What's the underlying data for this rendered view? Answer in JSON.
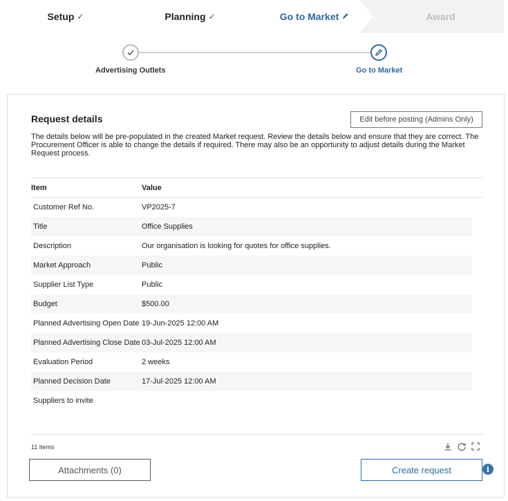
{
  "stages": [
    {
      "label": "Setup",
      "status": "done"
    },
    {
      "label": "Planning",
      "status": "done"
    },
    {
      "label": "Go to Market",
      "status": "active"
    },
    {
      "label": "Award",
      "status": "pending"
    }
  ],
  "stepper": {
    "steps": [
      {
        "label": "Advertising Outlets",
        "status": "done"
      },
      {
        "label": "Go to Market",
        "status": "active"
      }
    ]
  },
  "card": {
    "title": "Request details",
    "edit_button": "Edit before posting (Admins Only)",
    "description": "The details below will be pre-populated in the created Market request. Review the details below and ensure that they are correct. The Procurement Officer is able to change the details if required. There may also be an opportunity to adjust details during the Market Request process."
  },
  "table": {
    "headers": {
      "item": "Item",
      "value": "Value"
    },
    "rows": [
      {
        "item": "Customer Ref No.",
        "value": "VP2025-7"
      },
      {
        "item": "Title",
        "value": "Office Supplies"
      },
      {
        "item": "Description",
        "value": "Our organisation is looking for quotes for office supplies."
      },
      {
        "item": "Market Approach",
        "value": "Public"
      },
      {
        "item": "Supplier List Type",
        "value": "Public"
      },
      {
        "item": "Budget",
        "value": "$500.00"
      },
      {
        "item": "Planned Advertising Open Date",
        "value": "19-Jun-2025 12:00 AM"
      },
      {
        "item": "Planned Advertising Close Date",
        "value": "03-Jul-2025 12:00 AM"
      },
      {
        "item": "Evaluation Period",
        "value": "2 weeks"
      },
      {
        "item": "Planned Decision Date",
        "value": "17-Jul-2025 12:00 AM"
      },
      {
        "item": "Suppliers to invite",
        "value": ""
      }
    ]
  },
  "footer": {
    "items_count": "11 items",
    "attachments_button": "Attachments (0)",
    "create_button": "Create request"
  },
  "colors": {
    "accent": "#2b6aa3",
    "muted": "#bdbdbd",
    "alt_row": "#f6f6f6"
  }
}
